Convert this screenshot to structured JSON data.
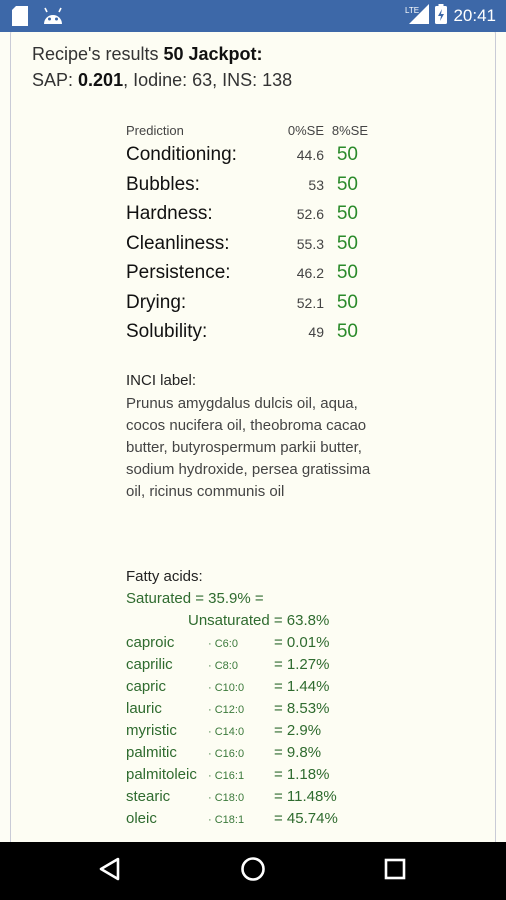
{
  "status_bar": {
    "time": "20:41",
    "network": "LTE"
  },
  "header": {
    "line1_prefix": "Recipe's results ",
    "line1_bold": "50 Jackpot:",
    "sap_label": "SAP: ",
    "sap_value": "0.201",
    "rest": ", Iodine: 63, INS: 138"
  },
  "prediction": {
    "title": "Prediction",
    "col1": "0%SE",
    "col2": "8%SE",
    "rows": [
      {
        "name": "Conditioning:",
        "v0": "44.6",
        "v8": "50"
      },
      {
        "name": "Bubbles:",
        "v0": "53",
        "v8": "50"
      },
      {
        "name": "Hardness:",
        "v0": "52.6",
        "v8": "50"
      },
      {
        "name": "Cleanliness:",
        "v0": "55.3",
        "v8": "50"
      },
      {
        "name": "Persistence:",
        "v0": "46.2",
        "v8": "50"
      },
      {
        "name": "Drying:",
        "v0": "52.1",
        "v8": "50"
      },
      {
        "name": "Solubility:",
        "v0": "49",
        "v8": "50"
      }
    ]
  },
  "inci": {
    "title": "INCI label:",
    "text": "Prunus amygdalus dulcis oil, aqua, cocos nucifera oil, theobroma cacao butter, butyrospermum parkii butter, sodium hydroxide, persea gratissima oil, ricinus communis oil"
  },
  "fatty_acids": {
    "title": "Fatty acids:",
    "saturated": "Saturated = 35.9% =",
    "unsaturated": "Unsaturated = 63.8%",
    "rows": [
      {
        "name": "caproic",
        "code": "· C6:0",
        "pct": "= 0.01%"
      },
      {
        "name": "caprilic",
        "code": "· C8:0",
        "pct": "= 1.27%"
      },
      {
        "name": "capric",
        "code": "· C10:0",
        "pct": "= 1.44%"
      },
      {
        "name": "lauric",
        "code": "· C12:0",
        "pct": "= 8.53%"
      },
      {
        "name": "myristic",
        "code": "· C14:0",
        "pct": "= 2.9%"
      },
      {
        "name": "palmitic",
        "code": "· C16:0",
        "pct": "= 9.8%"
      },
      {
        "name": "palmitoleic",
        "code": "· C16:1",
        "pct": "= 1.18%"
      },
      {
        "name": "stearic",
        "code": "· C18:0",
        "pct": "= 11.48%"
      },
      {
        "name": "oleic",
        "code": "· C18:1",
        "pct": "= 45.74%"
      }
    ]
  },
  "icons": {
    "status_left": [
      "sd-card-icon",
      "android-icon"
    ],
    "status_right": [
      "lte-signal-icon",
      "battery-charging-icon"
    ],
    "nav": [
      "back-icon",
      "home-icon",
      "recents-icon"
    ]
  },
  "colors": {
    "status_bar": "#3d68a8",
    "value_green": "#2a8a2a",
    "fatty_green": "#2f6b2f",
    "background": "#fdfdf3"
  }
}
